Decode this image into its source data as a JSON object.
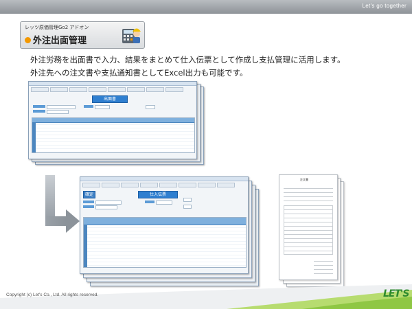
{
  "header": {
    "tagline": "Let's go together"
  },
  "product": {
    "subtitle": "レッツ原価管理Go2 アドオン",
    "title": "外注出面管理"
  },
  "description": {
    "line1": "外注労務を出面書で入力、結果をまとめて仕入伝票として作成し支払管理に活用します。",
    "line2": "外注先への注文書や支払通知書としてExcel出力も可能です。"
  },
  "screens": {
    "top_window_title": "出面書",
    "bottom_window_title": "仕入伝票",
    "bottom_window_button": "確定"
  },
  "sheets": {
    "title": "注文書"
  },
  "footer": {
    "copyright": "Copyright (c) Let's Co., Ltd. All rights reserved.",
    "logo": "LET'S"
  },
  "colors": {
    "accent_orange": "#f39800",
    "screen_blue": "#2f7fd0",
    "logo_green": "#2e8a2e",
    "band_gray": "#8e9398"
  }
}
